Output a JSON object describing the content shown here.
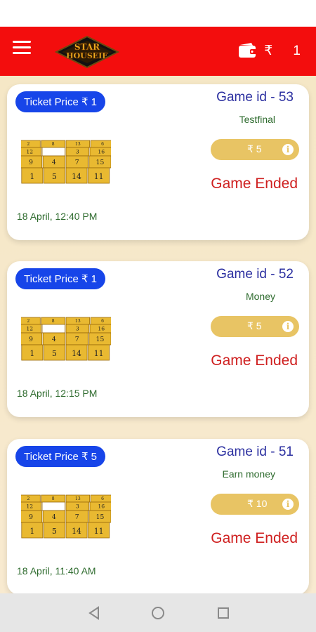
{
  "app": {
    "wallet_amount": "₹ 1",
    "logo_text_top": "STAR",
    "logo_text_bottom": "HOUSEIE"
  },
  "games": [
    {
      "ticket_price": "Ticket Price ₹ 1",
      "game_id": "Game id - 53",
      "name": "Testfinal",
      "prize": "₹ 5",
      "status": "Game Ended",
      "date": "18 April, 12:40 PM"
    },
    {
      "ticket_price": "Ticket Price ₹ 1",
      "game_id": "Game id - 52",
      "name": "Money",
      "prize": "₹ 5",
      "status": "Game Ended",
      "date": "18 April, 12:15 PM"
    },
    {
      "ticket_price": "Ticket Price ₹ 5",
      "game_id": "Game id - 51",
      "name": "Earn money",
      "prize": "₹ 10",
      "status": "Game Ended",
      "date": "18 April, 11:40 AM"
    }
  ],
  "ticket_numbers": [
    "2",
    "8",
    "13",
    "6",
    "12",
    "",
    "3",
    "16",
    "9",
    "4",
    "7",
    "15",
    "1",
    "5",
    "14",
    "11"
  ],
  "colors": {
    "app_bar": "#f30d0d",
    "pill": "#1745e9",
    "prize": "#e8c464",
    "status": "#cf2020",
    "id": "#2b2fa0",
    "date": "#2e6b2e"
  }
}
